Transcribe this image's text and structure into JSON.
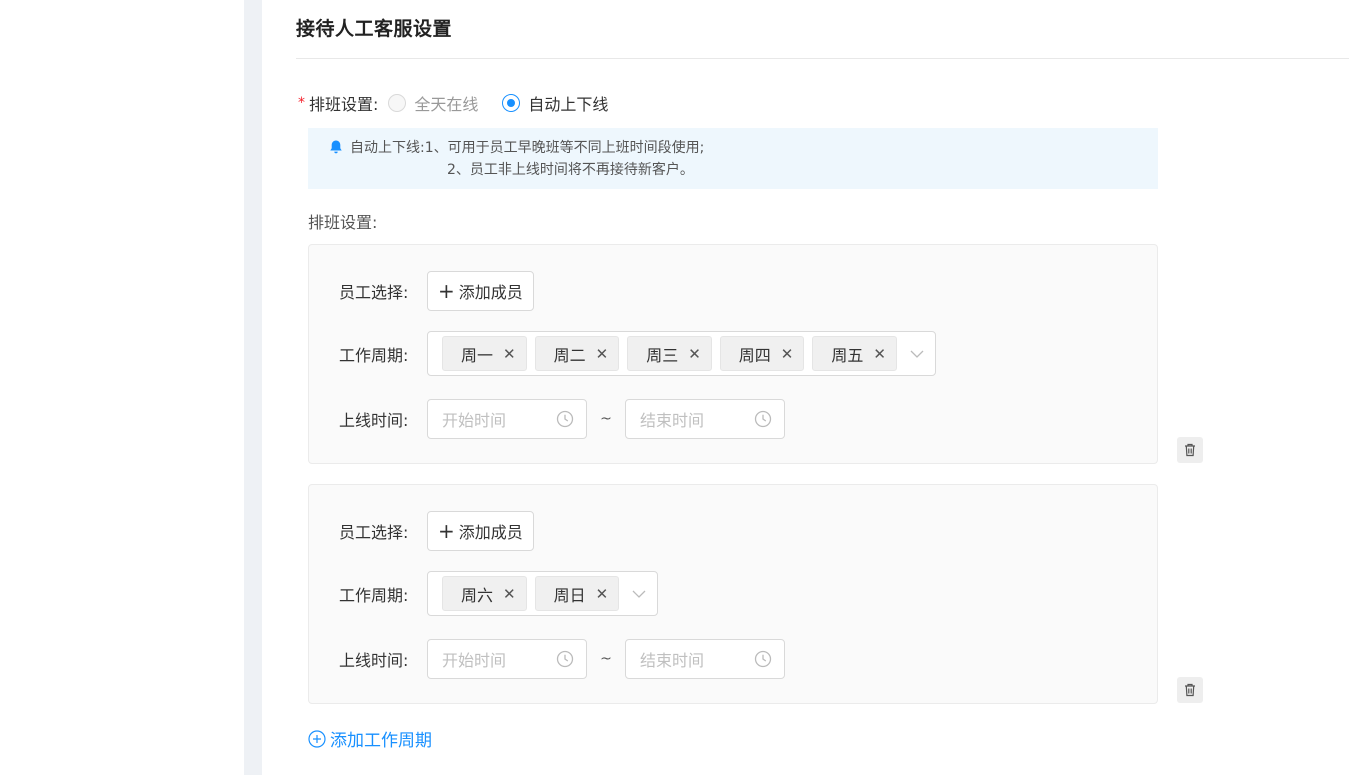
{
  "section": {
    "title": "接待人工客服设置"
  },
  "mode": {
    "required_mark": "*",
    "label": "排班设置:",
    "options": [
      {
        "label": "全天在线",
        "checked": false,
        "disabled": true
      },
      {
        "label": "自动上下线",
        "checked": true,
        "disabled": false
      }
    ]
  },
  "tip": {
    "prefix": "自动上下线:",
    "line1": "1、可用于员工早晚班等不同上班时间段使用;",
    "line2": "2、员工非上线时间将不再接待新客户。",
    "icon": "bell-icon",
    "icon_color": "#1890ff"
  },
  "schedule": {
    "label": "排班设置:"
  },
  "periods": [
    {
      "staff_label": "员工选择:",
      "add_member_label": "添加成员",
      "weekdays_label": "工作周期:",
      "days": [
        "周一",
        "周二",
        "周三",
        "周四",
        "周五"
      ],
      "time_label": "上线时间:",
      "start_placeholder": "开始时间",
      "end_placeholder": "结束时间",
      "separator": "~"
    },
    {
      "staff_label": "员工选择:",
      "add_member_label": "添加成员",
      "weekdays_label": "工作周期:",
      "days": [
        "周六",
        "周日"
      ],
      "time_label": "上线时间:",
      "start_placeholder": "开始时间",
      "end_placeholder": "结束时间",
      "separator": "~"
    }
  ],
  "add_period": {
    "label": "添加工作周期"
  },
  "colors": {
    "accent": "#1890ff",
    "required": "#f5222d",
    "tip_bg": "#eef7fd"
  }
}
